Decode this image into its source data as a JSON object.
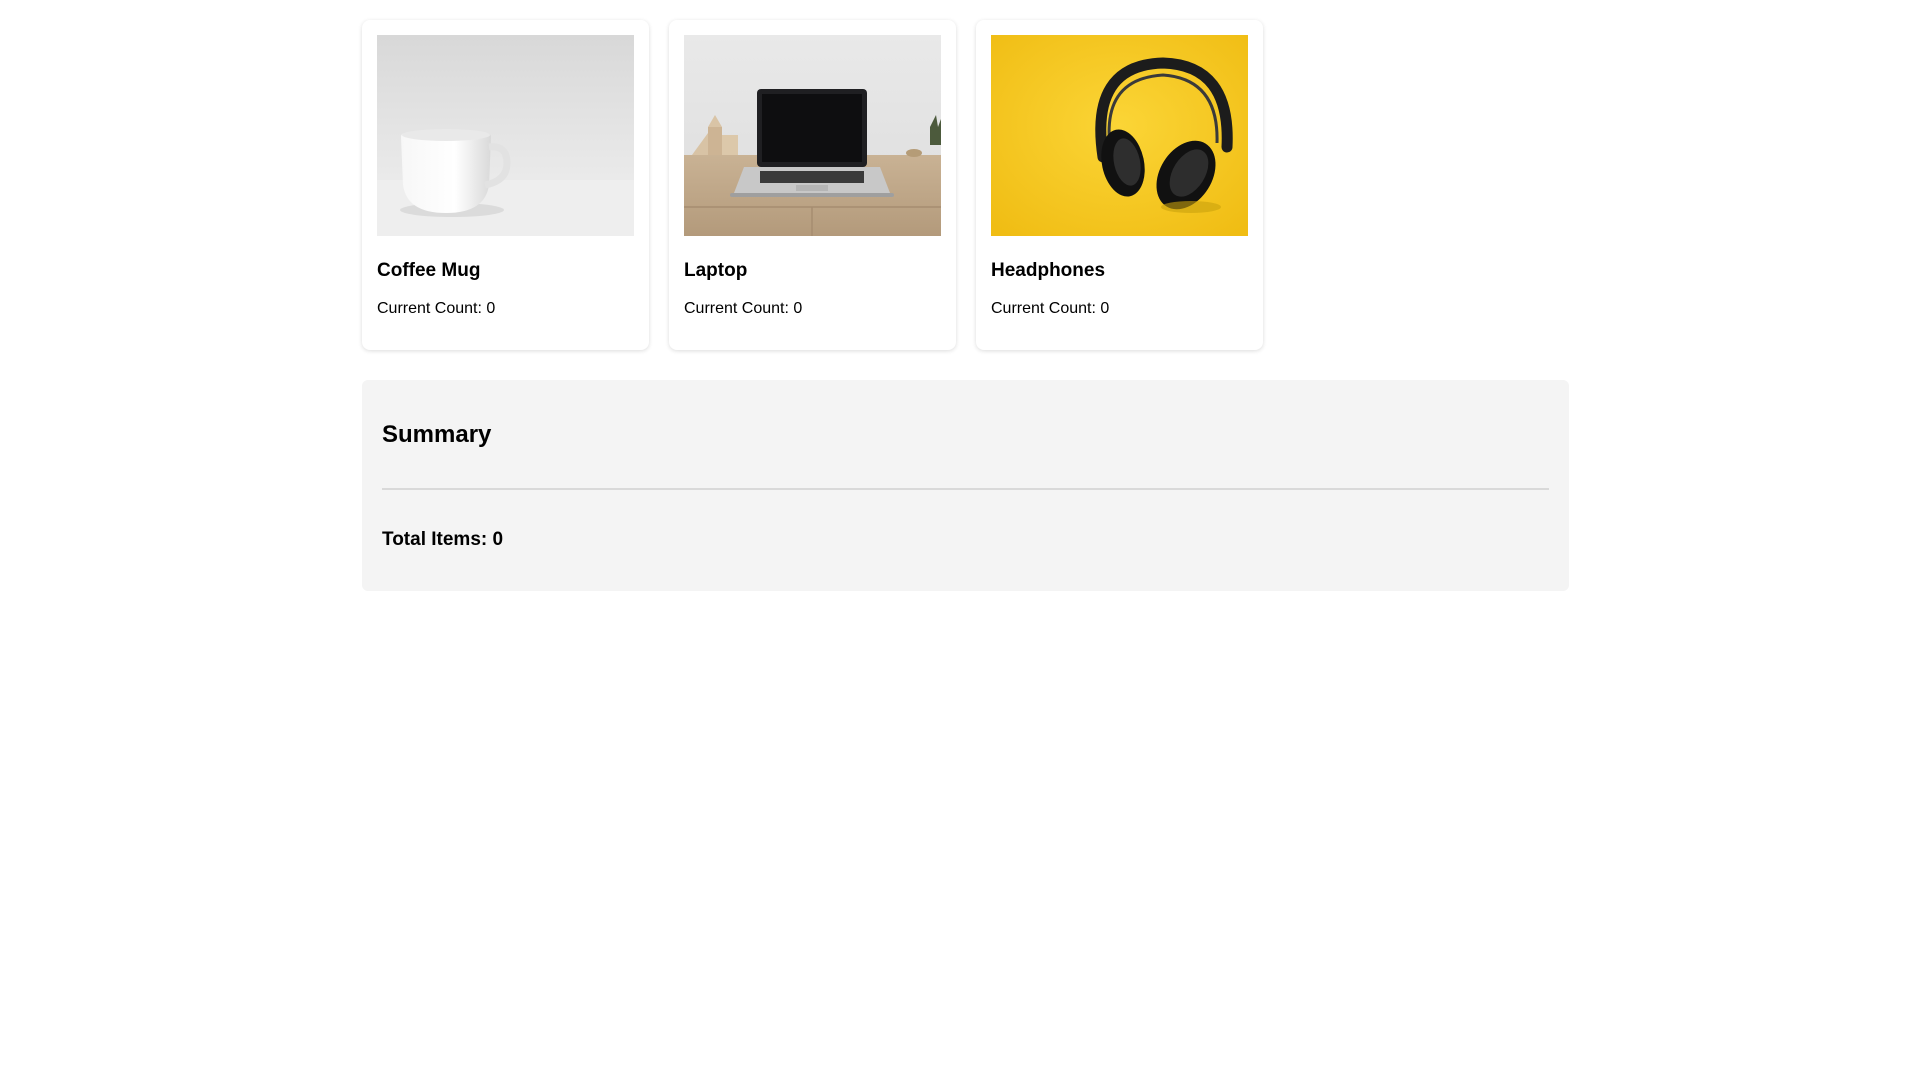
{
  "products": [
    {
      "name": "Coffee Mug",
      "count_text": "Current Count: 0",
      "image_icon": "coffee-mug-image"
    },
    {
      "name": "Laptop",
      "count_text": "Current Count: 0",
      "image_icon": "laptop-image"
    },
    {
      "name": "Headphones",
      "count_text": "Current Count: 0",
      "image_icon": "headphones-image"
    }
  ],
  "summary": {
    "title": "Summary",
    "total_text": "Total Items: 0"
  },
  "colors": {
    "panel_background": "#f4f4f4",
    "divider": "#d9d9d9",
    "headphones_background": "#f4c418"
  }
}
